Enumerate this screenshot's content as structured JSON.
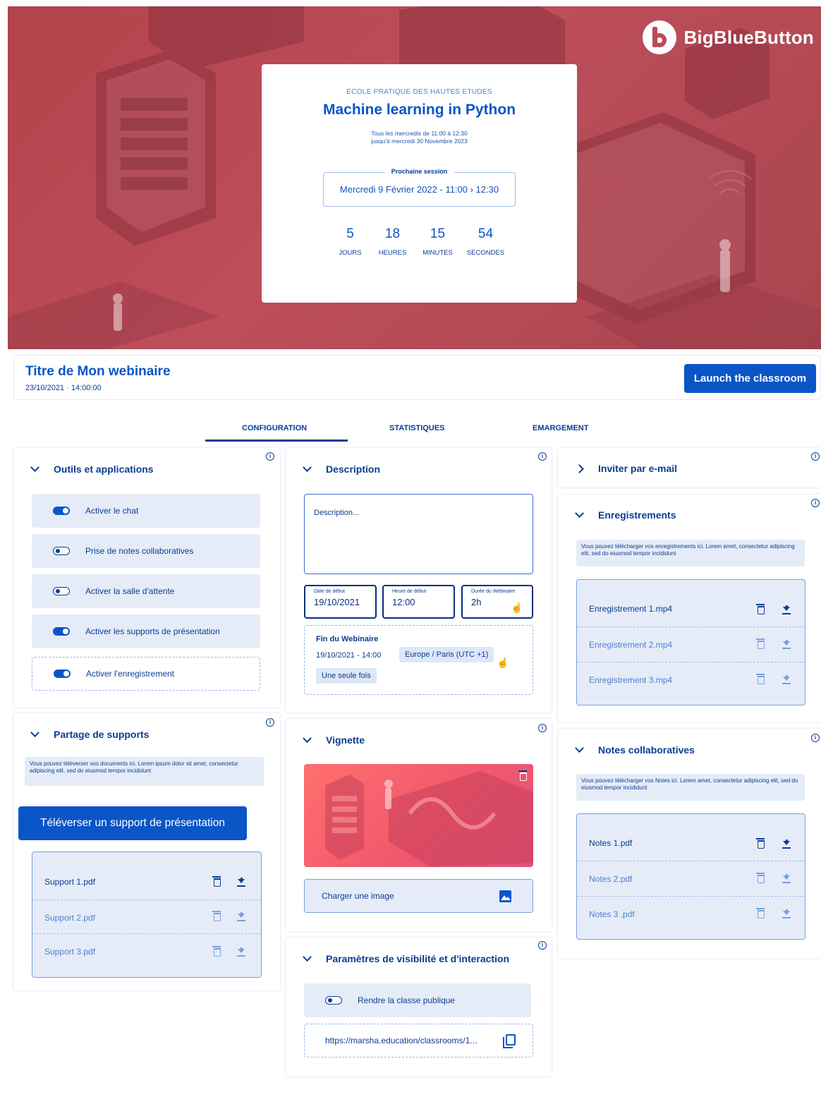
{
  "brand": {
    "name": "BigBlueButton"
  },
  "hero": {
    "school": "ECOLE PRATIQUE DES HAUTES ETUDES",
    "title": "Machine learning in Python",
    "schedule_line1": "Tous les mercredis de 11:00 à 12:30",
    "schedule_line2": "jusqu'à mercredi 30 Novembre 2023",
    "next_session_label": "Prochaine session",
    "next_session_value": "Mercredi 9 Février 2022  -  11:00 › 12:30",
    "countdown": [
      {
        "value": "5",
        "label": "JOURS"
      },
      {
        "value": "18",
        "label": "HEURES"
      },
      {
        "value": "15",
        "label": "MINUTES"
      },
      {
        "value": "54",
        "label": "SECONDES"
      }
    ]
  },
  "header": {
    "title": "Titre de Mon webinaire",
    "datetime": "23/10/2021  ·  14:00:00",
    "launch_label": "Launch the classroom"
  },
  "tabs": [
    {
      "label": "CONFIGURATION",
      "active": true
    },
    {
      "label": "STATISTIQUES",
      "active": false
    },
    {
      "label": "EMARGEMENT",
      "active": false
    }
  ],
  "tools": {
    "title": "Outils et applications",
    "items": [
      {
        "label": "Activer le chat",
        "on": true
      },
      {
        "label": "Prise de notes collaboratives",
        "on": false
      },
      {
        "label": "Activer la salle d'attente",
        "on": false
      },
      {
        "label": "Activer les supports de présentation",
        "on": true
      },
      {
        "label": "Activer l'enregistrement",
        "on": true
      }
    ]
  },
  "sharing": {
    "title": "Partage de supports",
    "note": "Vous pouvez téléverser vos documents ici. Lorem ipsum dolor sit amet, consectetur adipiscing elit, sed do eiusmod tempor incididunt",
    "upload_label": "Téléverser un support de présentation",
    "files": [
      "Support 1.pdf",
      "Support 2.pdf",
      "Support 3.pdf"
    ]
  },
  "description": {
    "title": "Description",
    "placeholder": "Description...",
    "start_date_label": "Date de début",
    "start_date": "19/10/2021",
    "start_time_label": "Heure de début",
    "start_time": "12:00",
    "duration_label": "Durée du Webinaire",
    "duration": "2h",
    "end_title": "Fin du Webinaire",
    "end_value": "19/10/2021 - 14:00",
    "timezone": "Europe /  Paris  (UTC +1)",
    "recurrence": "Une seule fois"
  },
  "vignette": {
    "title": "Vignette",
    "load_label": "Charger une image"
  },
  "visibility": {
    "title": "Paramètres de visibilité et d'interaction",
    "public_label": "Rendre la classe publique",
    "public_on": false,
    "url": "https://marsha.education/classrooms/1..."
  },
  "invite": {
    "title": "Inviter par e-mail"
  },
  "recordings": {
    "title": "Enregistrements",
    "note": "Vous pouvez télécharger vos enregistrements ici. Lorem amet, consectetur adipiscing elit, sed do eiusmod tempor incididunt",
    "files": [
      "Enregistrement 1.mp4",
      "Enregistrement 2.mp4",
      "Enregistrement 3.mp4"
    ]
  },
  "notes": {
    "title": "Notes collaboratives",
    "note": "Vous pouvez télécharger vos Notes ici. Lorem amet, consectetur adipiscing elit, sed do eiusmod tempor incididunt",
    "files": [
      "Notes 1.pdf",
      "Notes 2.pdf",
      "Notes 3 .pdf"
    ]
  },
  "info_glyph": "i",
  "colors": {
    "primary": "#0a55c8",
    "navy": "#0a3d91",
    "soft_bg": "#e5ecf8",
    "hero_red": "#b3434a"
  }
}
